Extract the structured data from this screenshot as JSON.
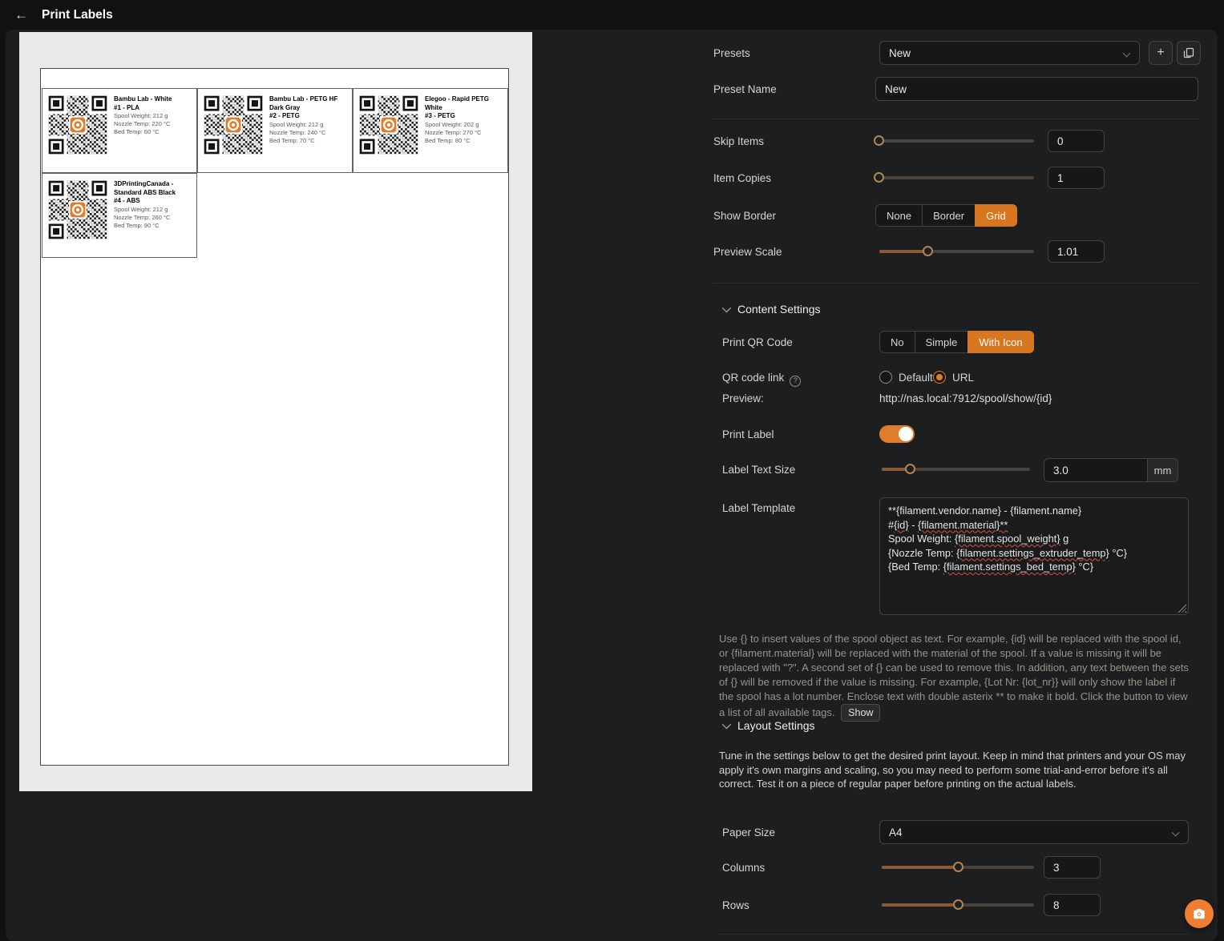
{
  "header": {
    "title": "Print Labels",
    "back": "←"
  },
  "presets": {
    "label": "Presets",
    "value": "New",
    "add_button": "+",
    "name_label": "Preset Name",
    "name_value": "New"
  },
  "controls": {
    "skip_items": {
      "label": "Skip Items",
      "value": "0"
    },
    "item_copies": {
      "label": "Item Copies",
      "value": "1"
    },
    "show_border": {
      "label": "Show Border",
      "options": [
        "None",
        "Border",
        "Grid"
      ],
      "selected": "Grid"
    },
    "preview_scale": {
      "label": "Preview Scale",
      "value": "1.01"
    }
  },
  "content_settings": {
    "title": "Content Settings",
    "print_qr": {
      "label": "Print QR Code",
      "options": [
        "No",
        "Simple",
        "With Icon"
      ],
      "selected": "With Icon"
    },
    "qr_link": {
      "label": "QR code link",
      "info_icon": "?",
      "options": [
        "Default",
        "URL"
      ],
      "selected": "URL"
    },
    "preview_row": {
      "label": "Preview:",
      "value": "http://nas.local:7912/spool/show/{id}"
    },
    "print_label": {
      "label": "Print Label",
      "enabled": true
    },
    "label_text_size": {
      "label": "Label Text Size",
      "value": "3.0",
      "unit": "mm"
    },
    "label_template": {
      "label": "Label Template",
      "lines": [
        {
          "a": "**{filament.vendor.name} - {filament.name}"
        },
        {
          "a": "#",
          "b": "{id}",
          "c": " - ",
          "d": "{filament.material}**"
        },
        {
          "a": "Spool Weight: ",
          "b": "{filament.spool_weight}",
          "c": " g"
        },
        {
          "a": "{Nozzle Temp: ",
          "b": "{filament.settings_extruder_temp}",
          "c": " °C}"
        },
        {
          "a": "{Bed Temp: ",
          "b": "{filament.settings_bed_temp}",
          "c": " °C}"
        }
      ]
    },
    "help_text": "Use {} to insert values of the spool object as text. For example, {id} will be replaced with the spool id, or {filament.material} will be replaced with the material of the spool. If a value is missing it will be replaced with \"?\". A second set of {} can be used to remove this. In addition, any text between the sets of {} will be removed if the value is missing. For example, {Lot Nr: {lot_nr}} will only show the label if the spool has a lot number. Enclose text with double asterix ** to make it bold. Click the button to view a list of all available tags.",
    "show_button": "Show"
  },
  "layout_settings": {
    "title": "Layout Settings",
    "description": "Tune in the settings below to get the desired print layout. Keep in mind that printers and your OS may apply it's own margins and scaling, so you may need to perform some trial-and-error before it's all correct. Test it on a piece of regular paper before printing on the actual labels.",
    "paper_size": {
      "label": "Paper Size",
      "value": "A4"
    },
    "columns": {
      "label": "Columns",
      "value": "3"
    },
    "rows": {
      "label": "Rows",
      "value": "8"
    }
  },
  "page_preview": {
    "labels": [
      {
        "name": "Bambu Lab - White",
        "id_line": "#1 - PLA",
        "weight": "Spool Weight: 212 g",
        "nozzle": "Nozzle Temp: 220 °C",
        "bed": "Bed Temp: 60 °C"
      },
      {
        "name": "Bambu Lab - PETG HF Dark Gray",
        "id_line": "#2 - PETG",
        "weight": "Spool Weight: 212 g",
        "nozzle": "Nozzle Temp: 240 °C",
        "bed": "Bed Temp: 70 °C"
      },
      {
        "name": "Elegoo - Rapid PETG White",
        "id_line": "#3 - PETG",
        "weight": "Spool Weight: 202 g",
        "nozzle": "Nozzle Temp: 270 °C",
        "bed": "Bed Temp: 80 °C"
      },
      {
        "name": "3DPrintingCanada - Standard ABS Black",
        "id_line": "#4 - ABS",
        "weight": "Spool Weight: 212 g",
        "nozzle": "Nozzle Temp: 260 °C",
        "bed": "Bed Temp: 90 °C"
      }
    ]
  }
}
